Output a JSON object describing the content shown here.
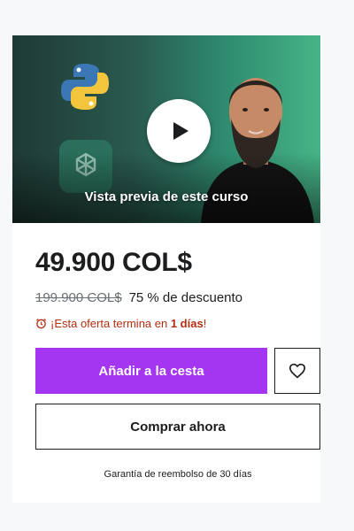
{
  "preview": {
    "label": "Vista previa de este curso",
    "icons": [
      "python-logo",
      "openai-logo",
      "play-icon"
    ]
  },
  "pricing": {
    "current_price": "49.900 COL$",
    "original_price": "199.900 COL$",
    "discount": "75 % de descuento"
  },
  "offer": {
    "prefix": "¡Esta oferta termina en ",
    "days": "1 días",
    "suffix": "!"
  },
  "actions": {
    "add_to_cart": "Añadir a la cesta",
    "buy_now": "Comprar ahora",
    "wishlist_icon": "heart-icon"
  },
  "guarantee": "Garantía de reembolso de 30 días",
  "colors": {
    "accent": "#a435f0",
    "offer_text": "#b32d0f",
    "text": "#1c1d1f"
  }
}
